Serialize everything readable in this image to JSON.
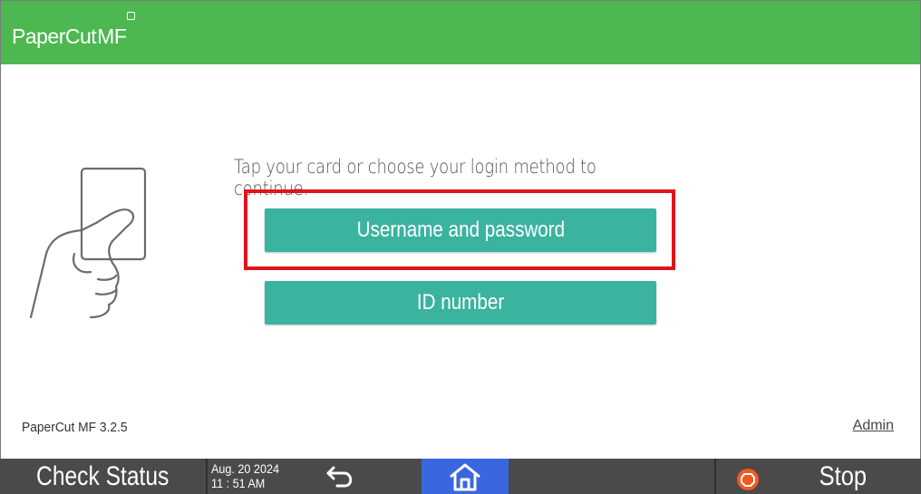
{
  "app": {
    "brand_name": "PaperCut",
    "brand_suffix": "MF"
  },
  "login": {
    "prompt": "Tap your card or choose your login method to continue.",
    "methods": [
      {
        "label": "Username and password"
      },
      {
        "label": "ID number"
      }
    ]
  },
  "footer": {
    "version": "PaperCut MF 3.2.5",
    "admin_link": "Admin"
  },
  "statusbar": {
    "check_status": "Check Status",
    "date": "Aug. 20 2024",
    "time": "11 : 51 AM",
    "stop": "Stop"
  },
  "colors": {
    "header_green": "#4db851",
    "button_teal": "#3ab39f",
    "highlight_red": "#e0141b",
    "statusbar_gray": "#4a4a4a",
    "home_blue": "#3a66e0",
    "stop_orange": "#f25a22"
  },
  "icons": {
    "card": "hand-holding-card-icon",
    "back": "back-arrow-icon",
    "home": "home-icon",
    "stop": "stop-icon"
  }
}
